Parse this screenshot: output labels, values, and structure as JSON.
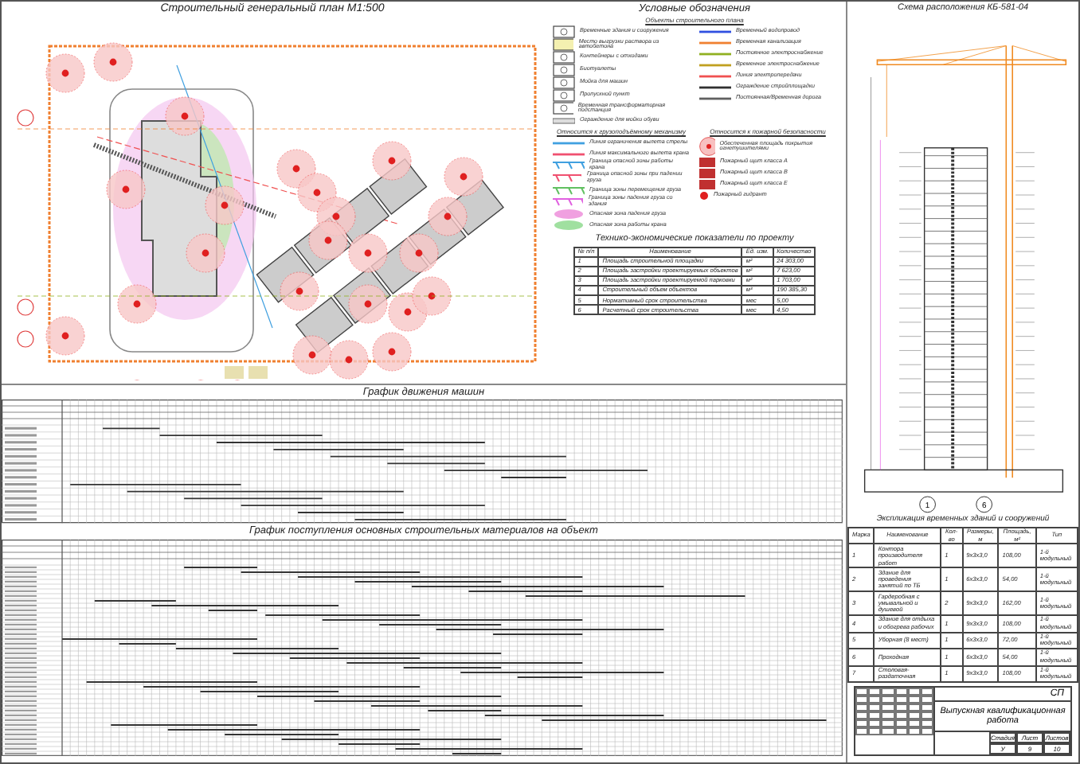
{
  "plan": {
    "title": "Строительный генеральный план М1:500"
  },
  "legend": {
    "title": "Условные обозначения",
    "subtitle": "Объекты строительного плана",
    "left_items": [
      {
        "kind": "box",
        "label": "Временные здания и сооружения"
      },
      {
        "kind": "boxfill",
        "label": "Место выгрузки раствора из автобетона"
      },
      {
        "kind": "box",
        "label": "Контейнеры с отходами"
      },
      {
        "kind": "box",
        "label": "Биотуалеты"
      },
      {
        "kind": "box",
        "label": "Мойка для машин"
      },
      {
        "kind": "box",
        "label": "Пропускной пункт"
      },
      {
        "kind": "box",
        "label": "Временная трансформаторная подстанция"
      },
      {
        "kind": "hatch",
        "label": "Ограждение для мойки обуви"
      }
    ],
    "right_items": [
      {
        "kind": "line",
        "color": "#3050e0",
        "label": "Временный водопровод"
      },
      {
        "kind": "line",
        "color": "#f08030",
        "label": "Временная канализация"
      },
      {
        "kind": "line",
        "color": "#90b020",
        "label": "Постоянное электроснабжение"
      },
      {
        "kind": "line",
        "color": "#c0a020",
        "label": "Временное электроснабжение"
      },
      {
        "kind": "line",
        "color": "#f05050",
        "label": "Линия электропередачи"
      },
      {
        "kind": "line",
        "color": "#303030",
        "label": "Ограждение стройплощадки"
      },
      {
        "kind": "line",
        "color": "#606060",
        "label": "Постоянная/Временная дорога"
      }
    ],
    "crane_heading": "Относится к грузоподъёмному механизму",
    "crane_items": [
      {
        "kind": "line",
        "color": "#40a0e0",
        "label": "Линия ограничения вылета стрелы"
      },
      {
        "kind": "line",
        "color": "#f05070",
        "label": "Линия максимального вылета крана"
      },
      {
        "kind": "zone",
        "color": "#40a0e0",
        "label": "Граница опасной зоны работы крана"
      },
      {
        "kind": "zone",
        "color": "#f05070",
        "label": "Граница опасной зоны при падении груза"
      },
      {
        "kind": "zone",
        "color": "#60c060",
        "label": "Граница зоны перемещения груза"
      },
      {
        "kind": "zone",
        "color": "#e060e0",
        "label": "Граница зоны падения груза со здания"
      },
      {
        "kind": "blob",
        "color": "#f0a0e0",
        "label": "Опасная зона падения груза"
      },
      {
        "kind": "blob",
        "color": "#a0e0a0",
        "label": "Опасная зона работы крана"
      }
    ],
    "safety_heading": "Относится к пожарной безопасности",
    "safety_items": [
      {
        "kind": "circle",
        "label": "Обеспеченная площадь покрытия огнетушителями"
      },
      {
        "kind": "shield",
        "label": "Пожарный щит класса А"
      },
      {
        "kind": "shield",
        "label": "Пожарный щит класса В"
      },
      {
        "kind": "shield",
        "label": "Пожарный щит класса Е"
      },
      {
        "kind": "dot",
        "label": "Пожарный гидрант"
      }
    ]
  },
  "tech_table": {
    "title": "Технико-экономические показатели по проекту",
    "columns": [
      "№ п/п",
      "Наименование",
      "Ед. изм.",
      "Количество"
    ],
    "rows": [
      [
        "1",
        "Площадь строительной площадки",
        "м²",
        "24 303,00"
      ],
      [
        "2",
        "Площадь застройки проектируемых объектов",
        "м²",
        "7 623,00"
      ],
      [
        "3",
        "Площадь застройки проектируемой парковки",
        "м²",
        "1 703,00"
      ],
      [
        "4",
        "Строительный объем объектов",
        "м³",
        "190 385,30"
      ],
      [
        "5",
        "Нормативный срок строительства",
        "мес",
        "5,00"
      ],
      [
        "6",
        "Расчетный срок строительства",
        "мес",
        "4,50"
      ]
    ]
  },
  "charts": [
    {
      "title": "График движения машин"
    },
    {
      "title": "График поступления основных строительных материалов на объект"
    }
  ],
  "crane_scheme": {
    "title": "Схема расположения КБ-581-04",
    "axes": [
      "1",
      "6"
    ]
  },
  "buildings_table": {
    "title": "Экспликация временных зданий и сооружений",
    "columns": [
      "Марка",
      "Наименование",
      "Кол-во",
      "Размеры, м",
      "Площадь, м²",
      "Тип"
    ],
    "rows": [
      [
        "1",
        "Контора производителя работ",
        "1",
        "9х3х3,0",
        "108,00",
        "1-й модульный"
      ],
      [
        "2",
        "Здание для проведения занятий по ТБ",
        "1",
        "6х3х3,0",
        "54,00",
        "1-й модульный"
      ],
      [
        "3",
        "Гардеробная с умывальной и душевой",
        "2",
        "9х3х3,0",
        "162,00",
        "1-й модульный"
      ],
      [
        "4",
        "Здание для отдыха и обогрева рабочих",
        "1",
        "9х3х3,0",
        "108,00",
        "1-й модульный"
      ],
      [
        "5",
        "Уборная (8 мест)",
        "1",
        "6х3х3,0",
        "72,00",
        "1-й модульный"
      ],
      [
        "6",
        "Проходная",
        "1",
        "6х3х3,0",
        "54,00",
        "1-й модульный"
      ],
      [
        "7",
        "Столовая-раздаточная",
        "1",
        "9х3х3,0",
        "108,00",
        "1-й модульный"
      ]
    ]
  },
  "title_block": {
    "code": "СП",
    "work": "Выпускная квалификационная работа",
    "stage_label": "Стадия",
    "sheet_label": "Лист",
    "sheets_label": "Листов",
    "stage": "У",
    "sheet": "9",
    "sheets": "10"
  }
}
